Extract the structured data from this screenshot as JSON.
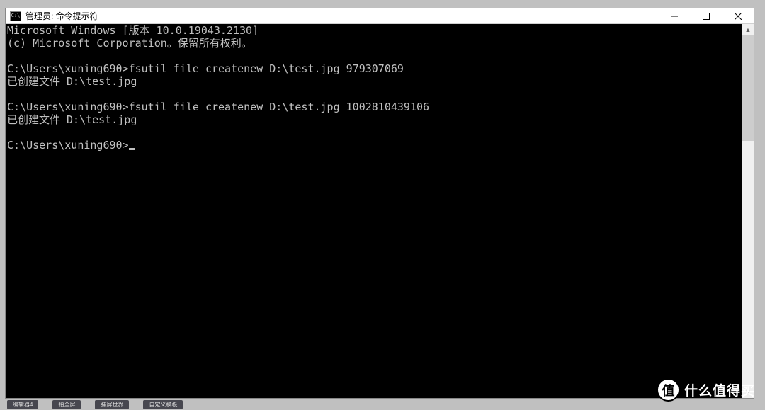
{
  "window": {
    "title": "管理员: 命令提示符",
    "icon_label": "C:\\"
  },
  "terminal": {
    "lines": [
      "Microsoft Windows [版本 10.0.19043.2130]",
      "(c) Microsoft Corporation。保留所有权利。",
      "",
      "C:\\Users\\xuning690>fsutil file createnew D:\\test.jpg 979307069",
      "已创建文件 D:\\test.jpg",
      "",
      "C:\\Users\\xuning690>fsutil file createnew D:\\test.jpg 1002810439106",
      "已创建文件 D:\\test.jpg",
      ""
    ],
    "prompt": "C:\\Users\\xuning690>"
  },
  "watermark": {
    "icon": "值",
    "text": "什么值得买"
  },
  "taskbar": {
    "items": [
      "编辑器4",
      "拍全屏",
      "捕屏世界",
      "自定义模板"
    ]
  }
}
